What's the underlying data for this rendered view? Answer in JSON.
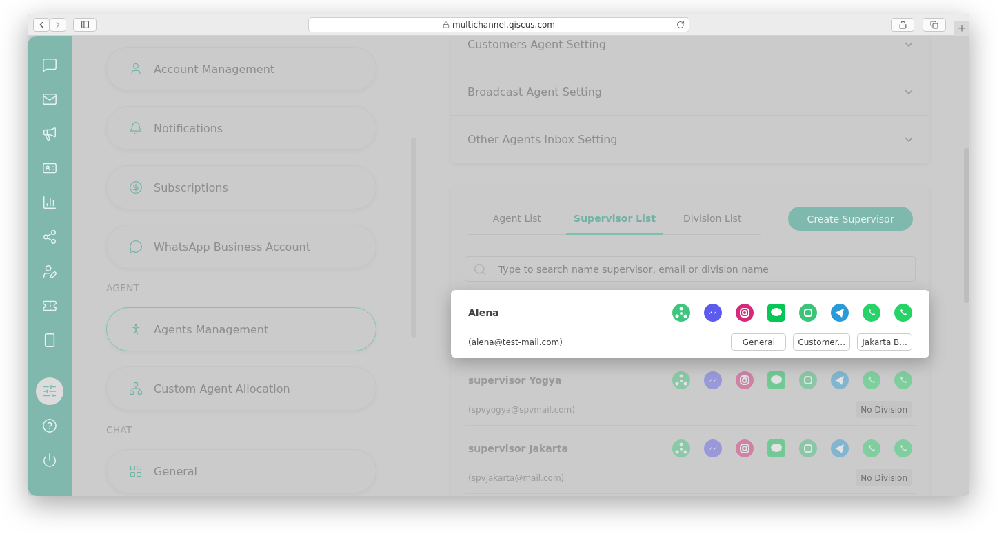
{
  "browser": {
    "url": "multichannel.qiscus.com"
  },
  "rail": {
    "items": [
      {
        "selected": false
      },
      {
        "selected": false
      },
      {
        "selected": false
      },
      {
        "selected": false
      },
      {
        "selected": false
      },
      {
        "selected": false
      },
      {
        "selected": false
      },
      {
        "selected": false
      },
      {
        "selected": false
      }
    ],
    "bottom_items": [
      {
        "selected": true
      },
      {
        "selected": false
      },
      {
        "selected": false
      }
    ]
  },
  "settings_menu": [
    {
      "items": [
        {
          "label": "Account Management",
          "selected": false
        },
        {
          "label": "Notifications",
          "selected": false
        },
        {
          "label": "Subscriptions",
          "selected": false
        },
        {
          "label": "WhatsApp Business Account",
          "selected": false
        }
      ]
    },
    {
      "heading": "AGENT",
      "items": [
        {
          "label": "Agents Management",
          "selected": true
        },
        {
          "label": "Custom Agent Allocation",
          "selected": false
        }
      ]
    },
    {
      "heading": "CHAT",
      "items": [
        {
          "label": "General",
          "selected": false
        }
      ]
    }
  ],
  "accordions": [
    {
      "title": "Customers Agent Setting",
      "expanded": false
    },
    {
      "title": "Broadcast Agent Setting",
      "expanded": false
    },
    {
      "title": "Other Agents Inbox Setting",
      "expanded": false
    }
  ],
  "tabs": [
    {
      "label": "Agent List",
      "selected": false
    },
    {
      "label": "Supervisor List",
      "selected": true
    },
    {
      "label": "Division List",
      "selected": false
    }
  ],
  "create_button": "Create Supervisor",
  "search": {
    "placeholder": "Type to search name supervisor, email or division name"
  },
  "supervisors": [
    {
      "name": "Alena",
      "email": "(alena@test-mail.com)",
      "highlighted": true,
      "divisions": [
        "General",
        "Customer...",
        "Jakarta B..."
      ]
    },
    {
      "name": "supervisor Yogya",
      "email": "(spvyogya@spvmail.com)",
      "highlighted": false,
      "divisions": [
        "No Division"
      ]
    },
    {
      "name": "supervisor Jakarta",
      "email": "(spvjakarta@mail.com)",
      "highlighted": false,
      "divisions": [
        "No Division"
      ]
    }
  ]
}
